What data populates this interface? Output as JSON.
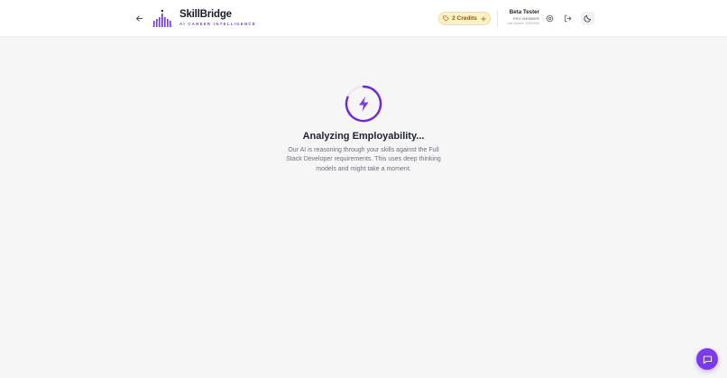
{
  "header": {
    "brand_name": "SkillBridge",
    "brand_tagline": "AI CAREER INTELLIGENCE",
    "credits_label": "2 Credits",
    "user": {
      "name": "Beta Tester",
      "role": "PRO MEMBER",
      "last_visited": "Last Visited: 3/26/2026"
    },
    "icons": {
      "back": "arrow-left-icon",
      "credits": "tag-icon",
      "credits_add": "plus-icon",
      "settings": "gear-icon",
      "logout": "logout-icon",
      "theme": "moon-icon"
    }
  },
  "main": {
    "spinner_icon": "lightning-icon",
    "title": "Analyzing Employability...",
    "description": "Our AI is reasoning through your skills against the Full Stack Developer requirements. This uses deep thinking models and might take a moment."
  },
  "chat": {
    "icon": "chat-bubble-icon"
  },
  "colors": {
    "accent": "#7c3aed",
    "background": "#f6f6f7",
    "credits_bg": "#fdf1c8"
  }
}
